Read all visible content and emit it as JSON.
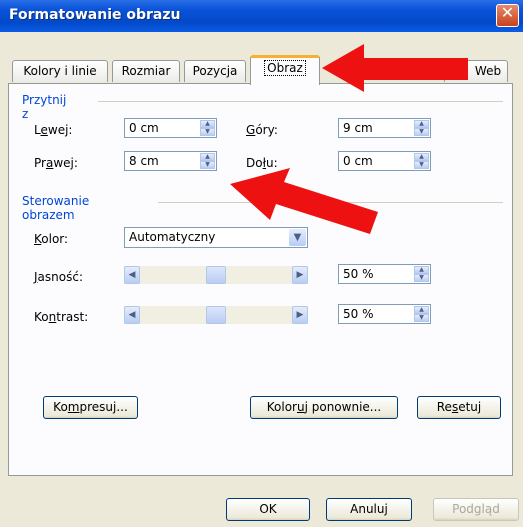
{
  "window": {
    "title": "Formatowanie obrazu"
  },
  "tabs": [
    {
      "label": "Kolory i linie"
    },
    {
      "label": "Rozmiar"
    },
    {
      "label": "Pozycja"
    },
    {
      "label": "Obraz",
      "active": true
    },
    {
      "label": "Web"
    }
  ],
  "crop": {
    "group_label": "Przytnij z",
    "left": {
      "label_pre": "L",
      "label_u": "e",
      "label_post": "wej:",
      "value": "0 cm"
    },
    "right": {
      "label_pre": "Pr",
      "label_u": "a",
      "label_post": "wej:",
      "value": "8 cm"
    },
    "top": {
      "label_pre": "",
      "label_u": "G",
      "label_post": "óry:",
      "value": "9 cm"
    },
    "bottom": {
      "label_pre": "Do",
      "label_u": "ł",
      "label_post": "u:",
      "value": "0 cm"
    }
  },
  "image_control": {
    "group_label": "Sterowanie obrazem",
    "color": {
      "label_pre": "",
      "label_u": "K",
      "label_post": "olor:",
      "value": "Automatyczny"
    },
    "brightness": {
      "label_pre": "",
      "label_u": "J",
      "label_post": "asność:",
      "value": "50 %",
      "level": 0.5
    },
    "contrast": {
      "label_pre": "Ko",
      "label_u": "n",
      "label_post": "trast:",
      "value": "50 %",
      "level": 0.5
    }
  },
  "buttons": {
    "compress": {
      "pre": "Ko",
      "u": "m",
      "post": "presuj..."
    },
    "recolor": {
      "pre": "Kolor",
      "u": "u",
      "post": "j ponownie..."
    },
    "reset": {
      "pre": "Re",
      "u": "s",
      "post": "etuj"
    },
    "ok": "OK",
    "cancel": "Anuluj",
    "preview": "Podgląd"
  },
  "colors": {
    "annotation_arrow": "#ee1111",
    "title_bar": "#0a53d8",
    "group_label": "#0046d5"
  }
}
